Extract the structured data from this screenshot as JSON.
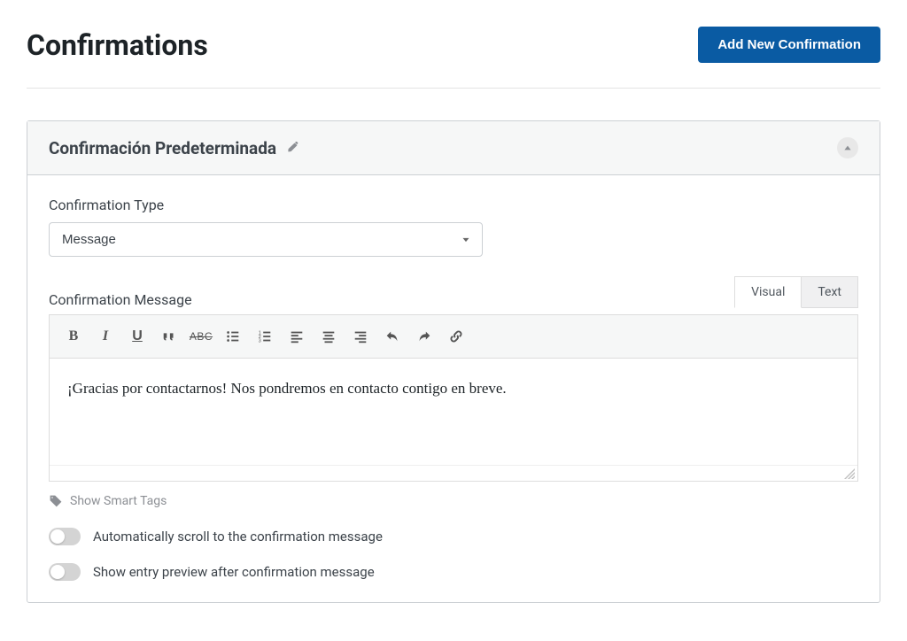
{
  "header": {
    "title": "Confirmations",
    "add_button": "Add New Confirmation"
  },
  "panel": {
    "title": "Confirmación Predeterminada"
  },
  "fields": {
    "type_label": "Confirmation Type",
    "type_value": "Message",
    "message_label": "Confirmation Message",
    "message_value": "¡Gracias por contactarnos! Nos pondremos en contacto contigo en breve."
  },
  "editor_tabs": {
    "visual": "Visual",
    "text": "Text"
  },
  "smart_tags": "Show Smart Tags",
  "toggles": {
    "auto_scroll": "Automatically scroll to the confirmation message",
    "entry_preview": "Show entry preview after confirmation message"
  }
}
